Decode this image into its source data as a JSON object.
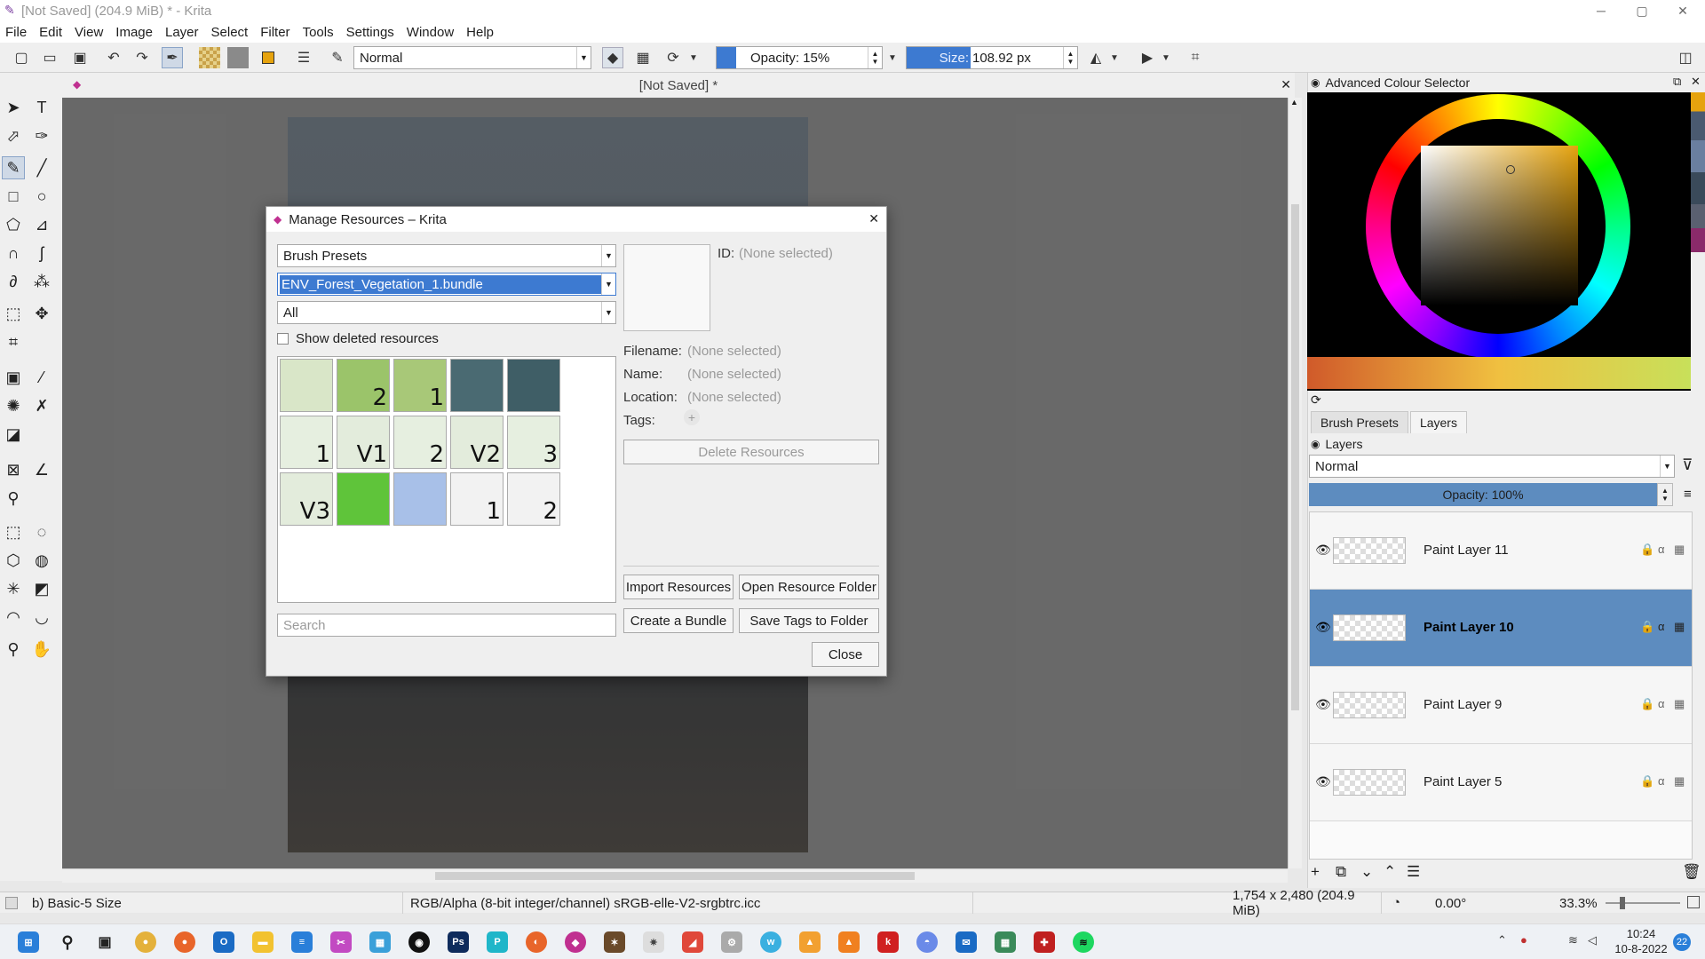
{
  "window": {
    "title": "[Not Saved]  (204.9 MiB)  * - Krita",
    "minimize": "─",
    "maximize": "▢",
    "close": "✕"
  },
  "menu": [
    "File",
    "Edit",
    "View",
    "Image",
    "Layer",
    "Select",
    "Filter",
    "Tools",
    "Settings",
    "Window",
    "Help"
  ],
  "toolbar": {
    "blend_mode": "Normal",
    "opacity": "Opacity: 15%",
    "size_label": "Size:",
    "size_value": "108.92 px"
  },
  "document": {
    "tab": "[Not Saved]  *"
  },
  "dialog": {
    "title": "Manage Resources – Krita",
    "resource_type": "Brush Presets",
    "storage": "ENV_Forest_Vegetation_1.bundle",
    "tag": "All",
    "show_deleted": "Show deleted resources",
    "search_placeholder": "Search",
    "id_label": "ID:",
    "id_value": "(None selected)",
    "filename_label": "Filename:",
    "filename_value": "(None selected)",
    "name_label": "Name:",
    "name_value": "(None selected)",
    "location_label": "Location:",
    "location_value": "(None selected)",
    "tags_label": "Tags:",
    "delete": "Delete Resources",
    "import": "Import Resources",
    "open_folder": "Open Resource Folder",
    "create_bundle": "Create a Bundle",
    "save_tags": "Save Tags to Folder",
    "close": "Close",
    "resources": [
      {
        "label": "",
        "bg": "#d9e6c8"
      },
      {
        "label": "2",
        "bg": "#9bc46a"
      },
      {
        "label": "1",
        "bg": "#a8c878"
      },
      {
        "label": "",
        "bg": "#4a6a72"
      },
      {
        "label": "",
        "bg": "#3f5e66"
      },
      {
        "label": "1",
        "bg": "#e6efe0"
      },
      {
        "label": "V1",
        "bg": "#e3ecdc"
      },
      {
        "label": "2",
        "bg": "#e6efe0"
      },
      {
        "label": "V2",
        "bg": "#e3ecdc"
      },
      {
        "label": "3",
        "bg": "#e6efe0"
      },
      {
        "label": "V3",
        "bg": "#e3ecdc"
      },
      {
        "label": "",
        "bg": "#5fc43a"
      },
      {
        "label": "",
        "bg": "#a8c0e8"
      },
      {
        "label": "1",
        "bg": "#f2f2f2"
      },
      {
        "label": "2",
        "bg": "#f2f2f2"
      }
    ]
  },
  "right_panel": {
    "colour_selector_title": "Advanced Colour Selector",
    "tabs": [
      "Brush Presets",
      "Layers"
    ],
    "layers_title": "Layers",
    "blend": "Normal",
    "opacity": "Opacity:  100%",
    "layers": [
      {
        "name": "Paint Layer 11",
        "selected": false
      },
      {
        "name": "Paint Layer 10",
        "selected": true
      },
      {
        "name": "Paint Layer 9",
        "selected": false
      },
      {
        "name": "Paint Layer 5",
        "selected": false
      }
    ]
  },
  "status": {
    "brush": "b) Basic-5 Size",
    "color_space": "RGB/Alpha (8-bit integer/channel)  sRGB-elle-V2-srgbtrc.icc",
    "dimensions": "1,754 x 2,480 (204.9 MiB)",
    "rotation": "0.00°",
    "zoom": "33.3%"
  },
  "taskbar": {
    "time": "10:24",
    "date": "10-8-2022",
    "notif": "22"
  },
  "colors": {
    "accent": "#3d7ad1",
    "selection": "#5d8cbf",
    "dialog_bg": "#efefef"
  }
}
